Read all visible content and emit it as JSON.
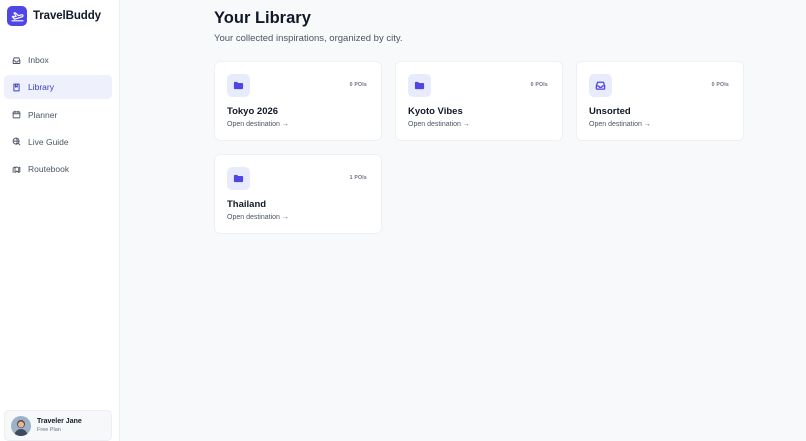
{
  "app": {
    "name": "TravelBuddy",
    "accent_color": "#4f46e5"
  },
  "sidebar": {
    "items": [
      {
        "label": "Inbox",
        "icon": "inbox-icon",
        "active": false
      },
      {
        "label": "Library",
        "icon": "book-icon",
        "active": true
      },
      {
        "label": "Planner",
        "icon": "calendar-icon",
        "active": false
      },
      {
        "label": "Live Guide",
        "icon": "globe-icon",
        "active": false
      },
      {
        "label": "Routebook",
        "icon": "map-icon",
        "active": false
      }
    ]
  },
  "user": {
    "name": "Traveler Jane",
    "plan": "Free Plan"
  },
  "header": {
    "title": "Your Library",
    "subtitle": "Your collected inspirations, organized by city."
  },
  "cards": [
    {
      "title": "Tokyo 2026",
      "badge": "0 POIs",
      "link": "Open destination →",
      "icon": "folder-icon"
    },
    {
      "title": "Kyoto Vibes",
      "badge": "0 POIs",
      "link": "Open destination →",
      "icon": "folder-icon"
    },
    {
      "title": "Unsorted",
      "badge": "0 POIs",
      "link": "Open destination →",
      "icon": "inbox-icon"
    },
    {
      "title": "Thailand",
      "badge": "1 POIs",
      "link": "Open destination →",
      "icon": "folder-icon"
    }
  ]
}
